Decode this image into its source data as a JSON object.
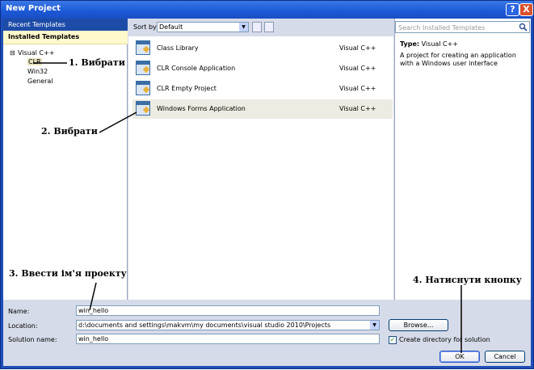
{
  "window": {
    "title": "New Project",
    "help_label": "?",
    "close_label": "X"
  },
  "left_panel": {
    "recent_label": "Recent Templates",
    "installed_label": "Installed Templates",
    "toggle": "⊟",
    "tree": [
      {
        "label": "Visual C++"
      },
      {
        "label": "CLR"
      },
      {
        "label": "Win32"
      },
      {
        "label": "General"
      }
    ]
  },
  "toolbar": {
    "sort_label": "Sort by:",
    "sort_value": "Default",
    "dropdown_arrow": "▼"
  },
  "templates": [
    {
      "name": "Class Library",
      "language": "Visual C++"
    },
    {
      "name": "CLR Console Application",
      "language": "Visual C++"
    },
    {
      "name": "CLR Empty Project",
      "language": "Visual C++"
    },
    {
      "name": "Windows Forms Application",
      "language": "Visual C++"
    }
  ],
  "details": {
    "search_placeholder": "Search Installed Templates",
    "type_label": "Type:",
    "type_value": "Visual C++",
    "description": "A project for creating an application with a Windows user interface"
  },
  "form": {
    "name_label": "Name:",
    "name_value": "win_hello",
    "location_label": "Location:",
    "location_value": "d:\\documents and settings\\makvm\\my documents\\visual studio 2010\\Projects",
    "solution_label": "Solution name:",
    "solution_value": "win_hello",
    "browse_label": "Browse...",
    "create_dir_label": "Create directory for solution",
    "create_dir_checked": true,
    "check_mark": "✓",
    "ok_label": "OK",
    "cancel_label": "Cancel"
  },
  "annotations": {
    "step1": "1. Вибрати",
    "step2": "2. Вибрати",
    "step3": "3. Ввести ім'я проекту",
    "step4": "4. Натиснути кнопку"
  },
  "colors": {
    "title_bar": "#1c58d6",
    "selection": "#ecece2",
    "installed_bg": "#fff9cc",
    "recent_bg": "#1d4ca8"
  }
}
